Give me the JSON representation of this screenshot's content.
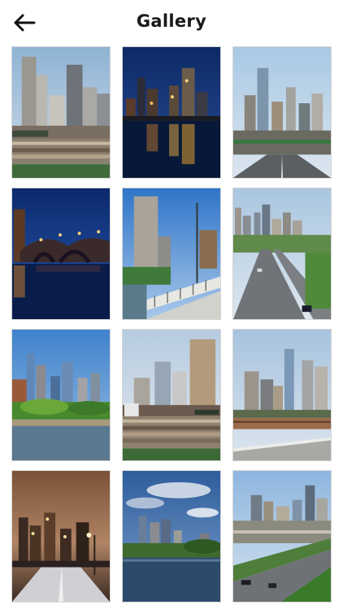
{
  "header": {
    "title": "Gallery",
    "back_icon": "arrow-left-icon"
  },
  "gallery": {
    "photos": [
      {
        "scene": "skyline-stadium-day"
      },
      {
        "scene": "skyline-night-reflection"
      },
      {
        "scene": "skyline-highway-day"
      },
      {
        "scene": "bridge-night-lights"
      },
      {
        "scene": "skyline-bridge-day"
      },
      {
        "scene": "highway-downtown-distant"
      },
      {
        "scene": "skyline-river-park"
      },
      {
        "scene": "skyline-stadium-crowd"
      },
      {
        "scene": "skyline-road-overpass"
      },
      {
        "scene": "bridge-street-lights-dusk"
      },
      {
        "scene": "skyline-river-clouds"
      },
      {
        "scene": "highway-skyline-aerial"
      }
    ]
  },
  "colors": {
    "background": "#ffffff",
    "title": "#1a1a1a",
    "tile_border": "#d6d6d6"
  }
}
